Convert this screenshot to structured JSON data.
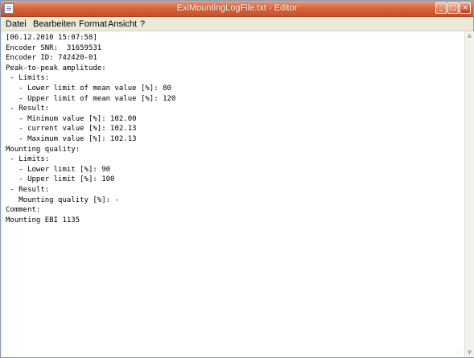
{
  "window": {
    "title": "ExiMountingLogFile.txt - Editor"
  },
  "titlebar_buttons": {
    "minimize_glyph": "_",
    "maximize_glyph": "□",
    "close_glyph": "×"
  },
  "menu": {
    "items": [
      "Datei",
      "Bearbeiten",
      "Format",
      "Ansicht",
      "?"
    ]
  },
  "editor": {
    "lines": [
      "[06.12.2010 15:07:58]",
      "Encoder SNR:  31659531",
      "Encoder ID: 742420-01",
      "Peak-to-peak amplitude:",
      " - Limits:",
      "   - Lower limit of mean value [%]: 80",
      "   - Upper limit of mean value [%]: 120",
      " - Result:",
      "   - Minimum value [%]: 102.00",
      "   - current value [%]: 102.13",
      "   - Maximum value [%]: 102.13",
      "Mounting quality:",
      " - Limits:",
      "   - Lower limit [%]: 90",
      "   - Upper limit [%]: 100",
      " - Result:",
      "   Mounting quality [%]: -",
      "Comment:",
      "Mounting EBI 1135"
    ]
  },
  "scrollbar": {
    "up_glyph": "▲",
    "down_glyph": "▼"
  },
  "icons": {
    "app": "notepad-icon",
    "minimize": "minimize-icon",
    "maximize": "maximize-icon",
    "close": "close-icon"
  },
  "colors": {
    "titlebar": "#d9683f",
    "menubar": "#ece9d8",
    "editor_background": "#ffffff",
    "text": "#000000"
  }
}
